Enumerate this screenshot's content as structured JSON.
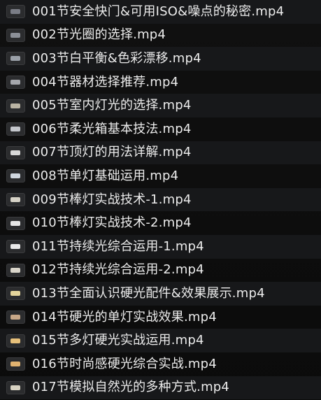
{
  "files": [
    {
      "name": "001节安全快门&可用ISO&噪点的秘密.mp4",
      "thumb_tone": "#7a7d86"
    },
    {
      "name": "002节光圈的选择.mp4",
      "thumb_tone": "#8b8f97"
    },
    {
      "name": "003节白平衡&色彩漂移.mp4",
      "thumb_tone": "#9aa0a8"
    },
    {
      "name": "004节器材选择推荐.mp4",
      "thumb_tone": "#a6a8ad"
    },
    {
      "name": "005节室内灯光的选择.mp4",
      "thumb_tone": "#b9b3a3"
    },
    {
      "name": "006节柔光箱基本技法.mp4",
      "thumb_tone": "#c4c7cc"
    },
    {
      "name": "007节顶灯的用法详解.mp4",
      "thumb_tone": "#d8d8d8"
    },
    {
      "name": "008节单灯基础运用.mp4",
      "thumb_tone": "#cfd6df"
    },
    {
      "name": "009节棒灯实战技术-1.mp4",
      "thumb_tone": "#d6d2c6"
    },
    {
      "name": "010节棒灯实战技术-2.mp4",
      "thumb_tone": "#e6e6e6"
    },
    {
      "name": "011节持续光综合运用-1.mp4",
      "thumb_tone": "#e9e9ea"
    },
    {
      "name": "012节持续光综合运用-2.mp4",
      "thumb_tone": "#d9d5ca"
    },
    {
      "name": "013节全面认识硬光配件&效果展示.mp4",
      "thumb_tone": "#e3d49b"
    },
    {
      "name": "014节硬光的单灯实战效果.mp4",
      "thumb_tone": "#c8a888"
    },
    {
      "name": "015节多灯硬光实战运用.mp4",
      "thumb_tone": "#e7c07a"
    },
    {
      "name": "016节时尚感硬光综合实战.mp4",
      "thumb_tone": "#e1b370"
    },
    {
      "name": "017节模拟自然光的多种方式.mp4",
      "thumb_tone": "#d7d2c2"
    }
  ]
}
